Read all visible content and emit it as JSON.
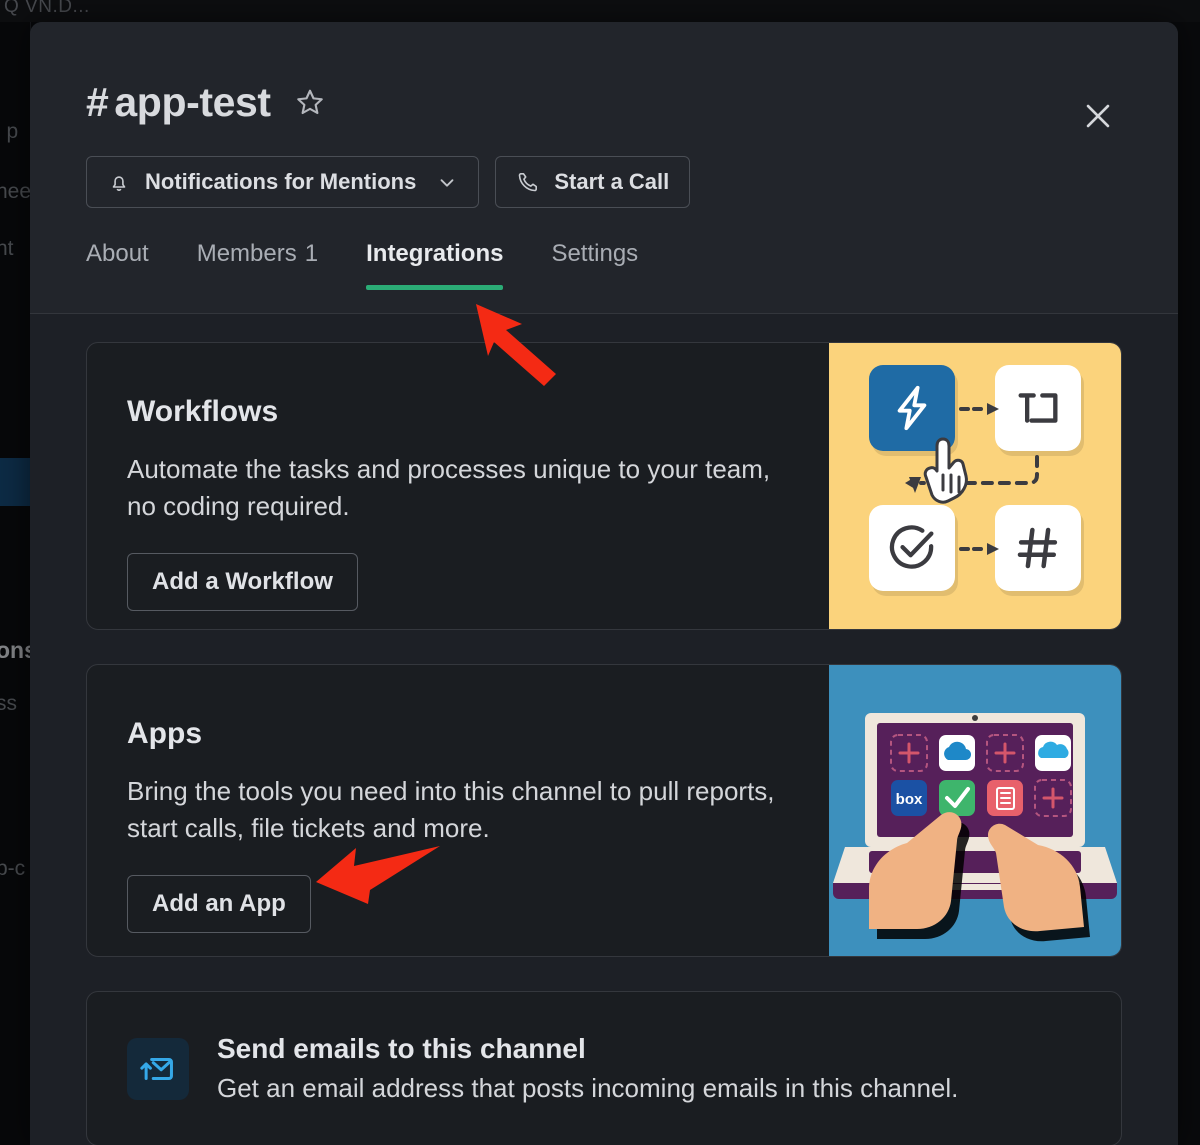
{
  "background": {
    "search_text": "Q  VN.D...",
    "fragments": [
      "l p",
      "nee",
      "nt",
      "ons",
      "ss",
      "b-c"
    ]
  },
  "modal": {
    "channel_prefix": "#",
    "channel_name": "app-test",
    "star_icon": "star-outline-icon",
    "close_icon": "close-icon",
    "buttons": {
      "notifications_label": "Notifications for Mentions",
      "notifications_icon": "bell-icon",
      "notifications_chevron": "chevron-down-icon",
      "call_label": "Start a Call",
      "call_icon": "phone-icon"
    },
    "tabs": [
      {
        "label": "About",
        "count": "",
        "active": false
      },
      {
        "label": "Members",
        "count": "1",
        "active": false
      },
      {
        "label": "Integrations",
        "count": "",
        "active": true
      },
      {
        "label": "Settings",
        "count": "",
        "active": false
      }
    ],
    "active_tab_color": "#2bac76"
  },
  "cards": [
    {
      "title": "Workflows",
      "description": "Automate the tasks and processes unique to your team, no coding required.",
      "button_label": "Add a Workflow",
      "art_name": "workflow-illustration",
      "art_background": "#fbd37c",
      "art_icons": [
        "lightning-bolt-icon",
        "text-field-icon",
        "check-circle-icon",
        "hash-icon",
        "pointing-hand-cursor-icon"
      ]
    },
    {
      "title": "Apps",
      "description": "Bring the tools you need into this channel to pull reports, start calls, file tickets and more.",
      "button_label": "Add an App",
      "art_name": "apps-illustration",
      "art_background": "#3d90bd",
      "art_icons": [
        "laptop-icon",
        "onedrive-icon",
        "salesforce-icon",
        "box-icon",
        "check-icon",
        "evernote-icon",
        "plus-placeholder-icon",
        "hands-icon"
      ]
    }
  ],
  "email_section": {
    "icon": "email-forward-icon",
    "icon_color": "#35a8e8",
    "title": "Send emails to this channel",
    "description": "Get an email address that posts incoming emails in this channel."
  },
  "annotations": {
    "arrow_color": "#f42a14",
    "arrow_tab_target": "Integrations",
    "arrow_app_target": "Add an App"
  }
}
